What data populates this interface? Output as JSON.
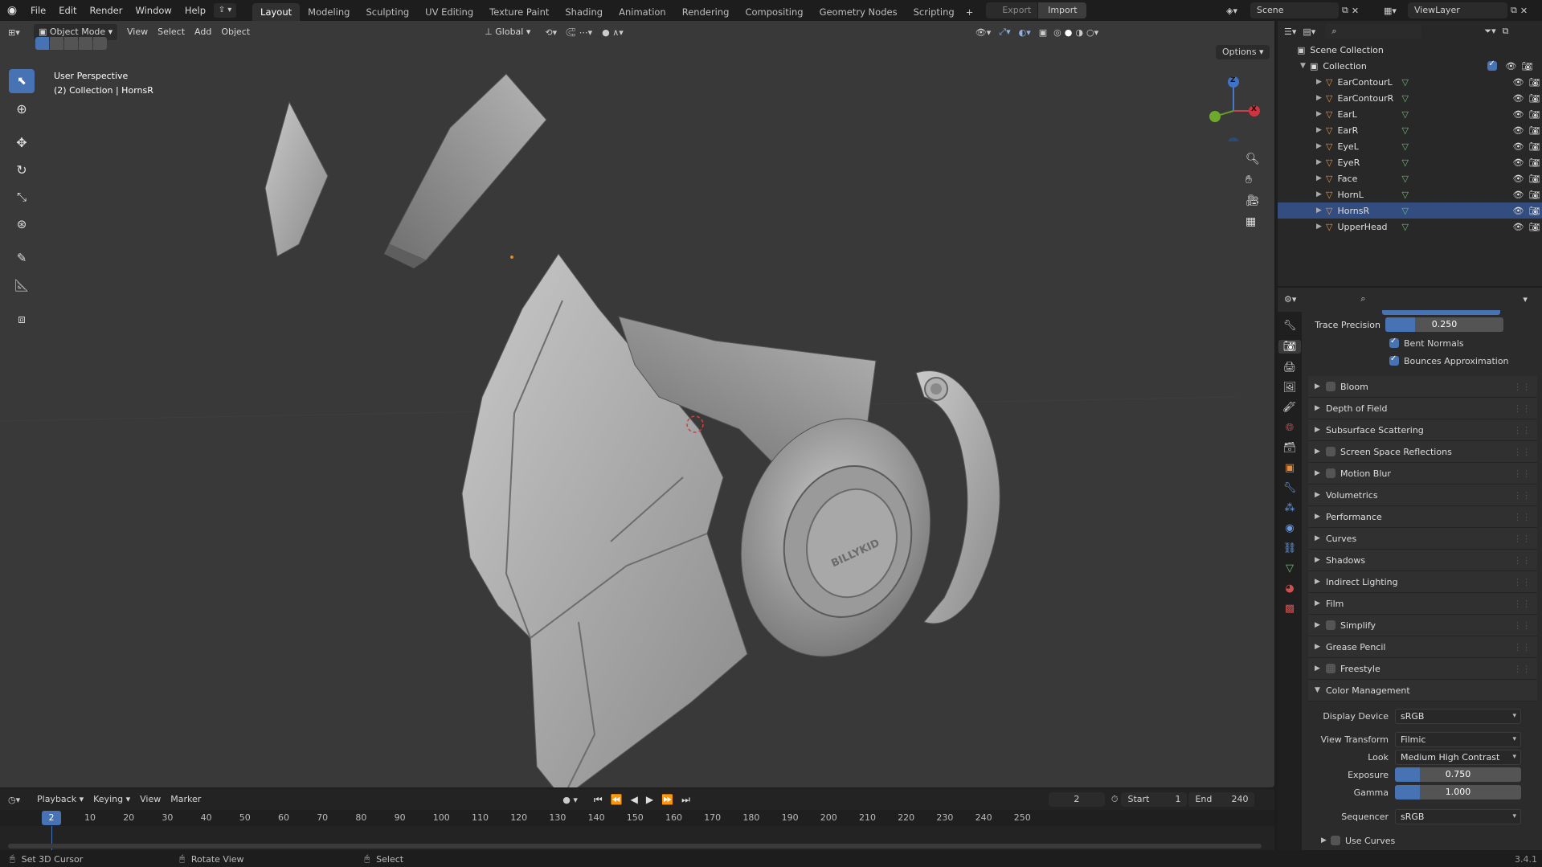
{
  "app": {
    "menus": [
      "File",
      "Edit",
      "Render",
      "Window",
      "Help"
    ],
    "workspaces": [
      "Layout",
      "Modeling",
      "Sculpting",
      "UV Editing",
      "Texture Paint",
      "Shading",
      "Animation",
      "Rendering",
      "Compositing",
      "Geometry Nodes",
      "Scripting"
    ],
    "active_workspace": "Layout",
    "export_label": "Export",
    "import_label": "Import",
    "scene_name": "Scene",
    "view_layer": "ViewLayer",
    "version": "3.4.1"
  },
  "viewport": {
    "mode": "Object Mode",
    "menus": [
      "View",
      "Select",
      "Add",
      "Object"
    ],
    "orientation": "Global",
    "options_label": "Options",
    "perspective_label": "User Perspective",
    "collection_label": "(2) Collection | HornsR",
    "emblem_text": "BILLYKID",
    "gizmo_axes": [
      "Z",
      "X"
    ]
  },
  "outliner": {
    "root": "Scene Collection",
    "collection": "Collection",
    "objects": [
      "EarContourL",
      "EarContourR",
      "EarL",
      "EarR",
      "EyeL",
      "EyeR",
      "Face",
      "HornL",
      "HornsR",
      "UpperHead"
    ]
  },
  "properties": {
    "trace_precision_label": "Trace Precision",
    "trace_precision_value": "0.250",
    "bent_normals": "Bent Normals",
    "bounces_approx": "Bounces Approximation",
    "panels": [
      {
        "label": "Bloom",
        "checkbox": true
      },
      {
        "label": "Depth of Field",
        "checkbox": false
      },
      {
        "label": "Subsurface Scattering",
        "checkbox": false
      },
      {
        "label": "Screen Space Reflections",
        "checkbox": true
      },
      {
        "label": "Motion Blur",
        "checkbox": true
      },
      {
        "label": "Volumetrics",
        "checkbox": false
      },
      {
        "label": "Performance",
        "checkbox": false
      },
      {
        "label": "Curves",
        "checkbox": false
      },
      {
        "label": "Shadows",
        "checkbox": false
      },
      {
        "label": "Indirect Lighting",
        "checkbox": false
      },
      {
        "label": "Film",
        "checkbox": false
      },
      {
        "label": "Simplify",
        "checkbox": true
      },
      {
        "label": "Grease Pencil",
        "checkbox": false
      },
      {
        "label": "Freestyle",
        "checkbox": true
      }
    ],
    "color_management": {
      "title": "Color Management",
      "display_device_label": "Display Device",
      "display_device": "sRGB",
      "view_transform_label": "View Transform",
      "view_transform": "Filmic",
      "look_label": "Look",
      "look": "Medium High Contrast",
      "exposure_label": "Exposure",
      "exposure": "0.750",
      "gamma_label": "Gamma",
      "gamma": "1.000",
      "sequencer_label": "Sequencer",
      "sequencer": "sRGB",
      "use_curves": "Use Curves"
    }
  },
  "timeline": {
    "menus": [
      "Playback",
      "Keying",
      "View",
      "Marker"
    ],
    "current_frame": "2",
    "start_label": "Start",
    "start": "1",
    "end_label": "End",
    "end": "240",
    "ruler": [
      "10",
      "20",
      "30",
      "40",
      "50",
      "60",
      "70",
      "80",
      "90",
      "100",
      "110",
      "120",
      "130",
      "140",
      "150",
      "160",
      "170",
      "180",
      "190",
      "200",
      "210",
      "220",
      "230",
      "240",
      "250"
    ]
  },
  "status": {
    "left": "Set 3D Cursor",
    "middle": "Rotate View",
    "right": "Select"
  }
}
